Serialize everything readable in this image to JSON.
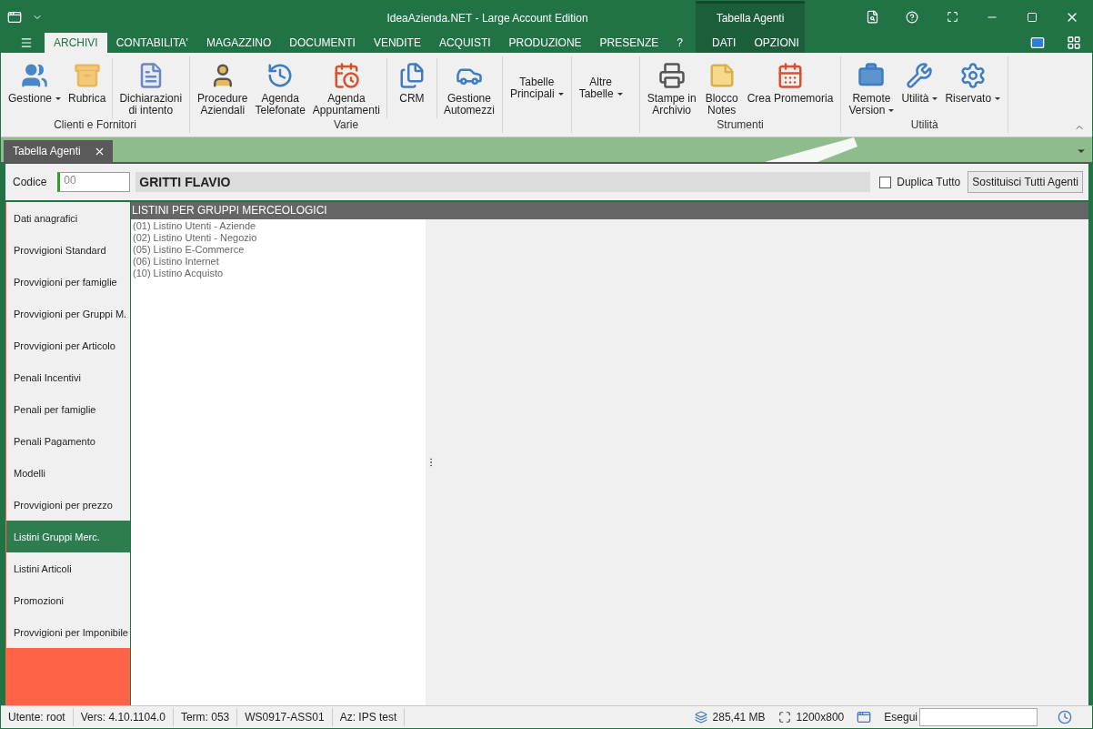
{
  "window": {
    "title": "IdeaAzienda.NET - Large Account Edition",
    "context_tab": "Tabella Agenti"
  },
  "ribbon_tabs": [
    {
      "label": "ARCHIVI",
      "selected": true,
      "context": false
    },
    {
      "label": "CONTABILITA'",
      "selected": false,
      "context": false
    },
    {
      "label": "MAGAZZINO",
      "selected": false,
      "context": false
    },
    {
      "label": "DOCUMENTI",
      "selected": false,
      "context": false
    },
    {
      "label": "VENDITE",
      "selected": false,
      "context": false
    },
    {
      "label": "ACQUISTI",
      "selected": false,
      "context": false
    },
    {
      "label": "PRODUZIONE",
      "selected": false,
      "context": false
    },
    {
      "label": "PRESENZE",
      "selected": false,
      "context": false
    },
    {
      "label": "?",
      "selected": false,
      "context": false
    },
    {
      "label": "DATI",
      "selected": false,
      "context": true
    },
    {
      "label": "OPZIONI",
      "selected": false,
      "context": true
    }
  ],
  "ribbon_groups": [
    {
      "label": "Clienti e Fornitori",
      "sections": [
        [
          {
            "label": "Gestione",
            "dropdown": true
          },
          {
            "label": "Rubrica",
            "dropdown": false
          }
        ],
        [
          {
            "label": "Dichiarazioni\ndi intento",
            "dropdown": false
          }
        ]
      ]
    },
    {
      "label": "Varie",
      "sections": [
        [
          {
            "label": "Procedure\nAziendali",
            "dropdown": false
          },
          {
            "label": "Agenda\nTelefonate",
            "dropdown": false
          },
          {
            "label": "Agenda\nAppuntamenti",
            "dropdown": false
          }
        ],
        [
          {
            "label": "CRM",
            "dropdown": false
          }
        ],
        [
          {
            "label": "Gestione\nAutomezzi",
            "dropdown": false
          }
        ]
      ]
    },
    {
      "sections": [
        [
          {
            "label": "Tabelle\nPrincipali",
            "dropdown": true
          }
        ]
      ]
    },
    {
      "sections": [
        [
          {
            "label": "Altre\nTabelle",
            "dropdown": true
          }
        ]
      ]
    },
    {
      "label": "Strumenti",
      "sections": [
        [
          {
            "label": "Stampe in\nArchivio",
            "dropdown": false
          },
          {
            "label": "Blocco\nNotes",
            "dropdown": false
          },
          {
            "label": "Crea Promemoria",
            "dropdown": false
          }
        ]
      ]
    },
    {
      "label": "Utilità",
      "sections": [
        [
          {
            "label": "Remote\nVersion",
            "dropdown": true
          },
          {
            "label": "Utilità",
            "dropdown": true
          },
          {
            "label": "Riservato",
            "dropdown": true
          }
        ]
      ]
    }
  ],
  "doc_tabs": [
    {
      "label": "Tabella Agenti",
      "selected": true
    }
  ],
  "header": {
    "code_label": "Codice",
    "code_value": "00",
    "name": "GRITTI FLAVIO",
    "duplicate": {
      "label": "Duplica Tutto",
      "checked": false
    },
    "button": "Sostituisci Tutti Agenti"
  },
  "nav": [
    {
      "label": "Dati anagrafici",
      "selected": false
    },
    {
      "label": "Provvigioni Standard",
      "selected": false
    },
    {
      "label": "Provvigioni per famiglie",
      "selected": false
    },
    {
      "label": "Provvigioni per Gruppi M.",
      "selected": false
    },
    {
      "label": "Provvigioni per Articolo",
      "selected": false
    },
    {
      "label": "Penali Incentivi",
      "selected": false
    },
    {
      "label": "Penali per famiglie",
      "selected": false
    },
    {
      "label": "Penali Pagamento",
      "selected": false
    },
    {
      "label": "Modelli",
      "selected": false
    },
    {
      "label": "Provvigioni per prezzo",
      "selected": false
    },
    {
      "label": "Listini Gruppi Merc.",
      "selected": true
    },
    {
      "label": "Listini Articoli",
      "selected": false
    },
    {
      "label": "Promozioni",
      "selected": false
    },
    {
      "label": "Provvigioni per Imponibile",
      "selected": false
    }
  ],
  "panel": {
    "title": "LISTINI PER GRUPPI MERCEOLOGICI",
    "items": [
      "(01) Listino Utenti - Aziende",
      "(02) Listino Utenti - Negozio",
      "(05) Listino E-Commerce",
      "(06) Listino Internet",
      "(10) Listino Acquisto"
    ]
  },
  "status_bar": {
    "left": [
      "Utente: root",
      "Vers: 4.10.1104.0",
      "Term: 053",
      "WS0917-ASS01",
      "Az: IPS test"
    ],
    "memory": "285,41 MB",
    "resolution": "1200x800",
    "run_label": "Esegui"
  }
}
